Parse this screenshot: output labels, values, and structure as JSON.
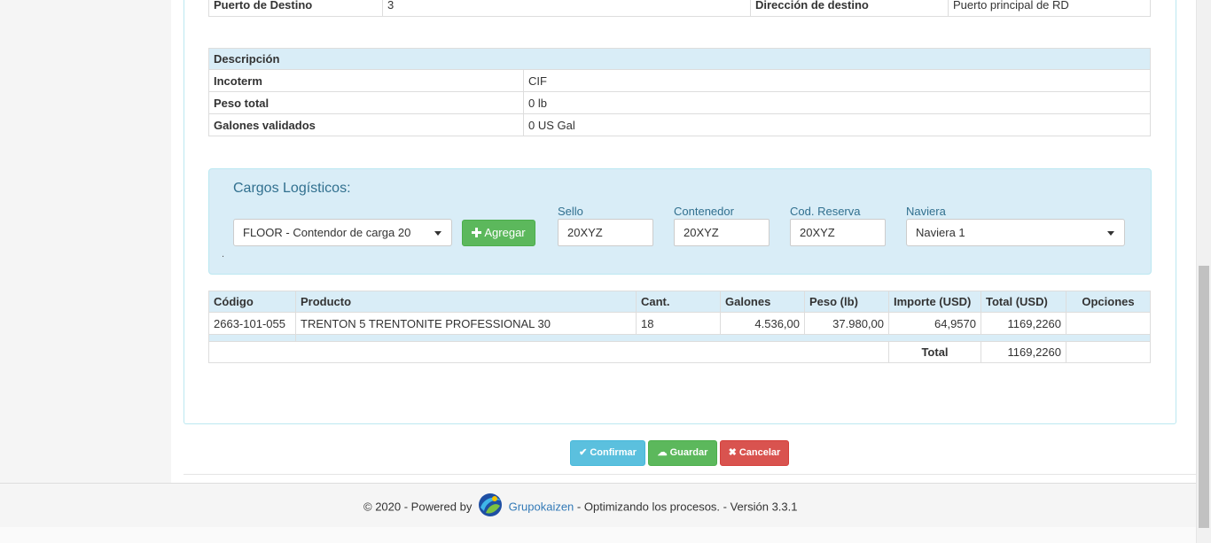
{
  "top_row": {
    "puerto_label": "Puerto de Destino",
    "puerto_value": "3",
    "direccion_label": "Dirección de destino",
    "direccion_value": "Puerto principal de RD"
  },
  "descripcion": {
    "header": "Descripción",
    "rows": [
      {
        "label": "Incoterm",
        "value": "CIF"
      },
      {
        "label": "Peso total",
        "value": "0 lb"
      },
      {
        "label": "Galones validados",
        "value": "0 US Gal"
      }
    ]
  },
  "cargos": {
    "title": "Cargos Logísticos:",
    "dot": ".",
    "cargo_select": "FLOOR - Contendor de carga 20",
    "agregar_label": "Agregar",
    "sello_label": "Sello",
    "sello_value": "20XYZ",
    "contenedor_label": "Contenedor",
    "contenedor_value": "20XYZ",
    "reserva_label": "Cod. Reserva",
    "reserva_value": "20XYZ",
    "naviera_label": "Naviera",
    "naviera_value": "Naviera 1"
  },
  "productos": {
    "headers": [
      "Código",
      "Producto",
      "Cant.",
      "Galones",
      "Peso (lb)",
      "Importe (USD)",
      "Total (USD)",
      "Opciones"
    ],
    "rows": [
      {
        "codigo": "2663-101-055",
        "producto": "TRENTON 5 TRENTONITE PROFESSIONAL 30",
        "cant": "18",
        "galones": "4.536,00",
        "peso": "37.980,00",
        "importe": "64,9570",
        "total": "1169,2260",
        "opciones": ""
      }
    ],
    "total_label": "Total",
    "total_value": "1169,2260"
  },
  "actions": {
    "confirmar": "Confirmar",
    "guardar": "Guardar",
    "cancelar": "Cancelar"
  },
  "footer": {
    "prefix": "© 2020 - Powered by",
    "brand": "Grupokaizen",
    "suffix": "- Optimizando los procesos. - Versión 3.3.1"
  },
  "colors": {
    "info_bg": "#d9edf7",
    "info_text": "#31708f",
    "success": "#5cb85c",
    "info_btn": "#5bc0de",
    "danger": "#d9534f",
    "link": "#337ab7"
  }
}
